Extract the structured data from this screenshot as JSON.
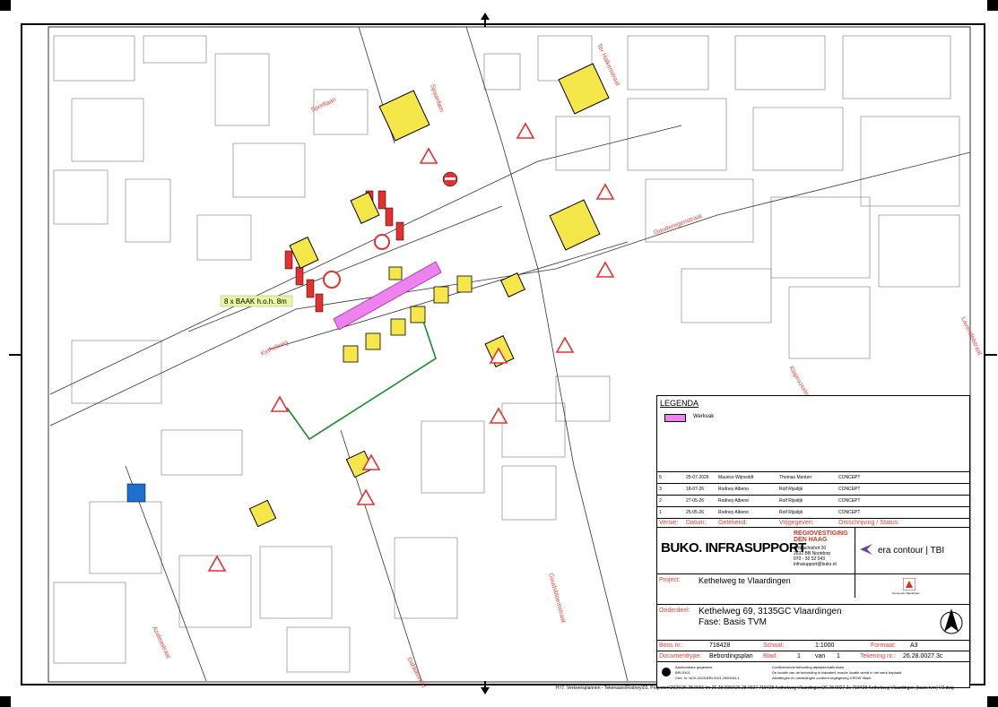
{
  "map_labels": {
    "streets": [
      "Sportlaan",
      "Spaardam",
      "Ter Halkenstraat",
      "Gouderegenstraat",
      "Klaproosstraat",
      "Lavendelstraat",
      "Kethelweg",
      "Goudsbloemstraat",
      "Azaleastraat",
      "Dahliastraat"
    ],
    "callout": "8 x BAAK h.o.h. 8m"
  },
  "legend": {
    "title": "LEGENDA",
    "items": [
      {
        "label": "Werkvak",
        "color": "#ee82ee"
      }
    ]
  },
  "revisions": {
    "headers": [
      "Versie:",
      "Datum:",
      "Getekend:",
      "Vrijgegeven:",
      "Omschrijving / Status:"
    ],
    "rows": [
      [
        "5",
        "25-07-2026",
        "Maurice Wijnvoldt",
        "Thomas Munten",
        "CONCEPT"
      ],
      [
        "3",
        "18-07-26",
        "Rodney Albeno",
        "Rolf Rijsdijk",
        "CONCEPT"
      ],
      [
        "2",
        "27-05-26",
        "Rodney Albeno",
        "Rolf Rijsdijk",
        "CONCEPT"
      ],
      [
        "1",
        "25-05-26",
        "Rodney Albeno",
        "Rolf Rijsdijk",
        "CONCEPT"
      ]
    ]
  },
  "company": {
    "logo": "BUKO. INFRASUPPORT",
    "region_title": "REGIOVESTIGING DEN HAAG",
    "address": [
      "Ambachtshof 20",
      "2632 BB Nootdorp",
      "070 - 30 52 043",
      "infrasupport@buko.nl"
    ],
    "partner": "era contour | TBI",
    "municipality": "Gemeente Vlaardingen"
  },
  "project": {
    "project_label": "Project:",
    "project": "Kethelweg te Vlaardingen",
    "onderdeel_label": "Onderdeel:",
    "onderdeel_line1": "Kethelweg 69, 3135GC Vlaardingen",
    "onderdeel_line2": "Fase: Basis TVM"
  },
  "meta": {
    "boss_label": "Boss nr.:",
    "boss": "718428",
    "schaal_label": "Schaal:",
    "schaal": "1:1000",
    "formaat_label": "Formaat:",
    "formaat": "A3",
    "doc_label": "Documenttype:",
    "doc": "Bebordingsplan",
    "blad_label": "Blad:",
    "blad": "1",
    "van": "van",
    "blad_total": "1",
    "tekening_label": "Tekening nr.:",
    "tekening": "26.28.0027.3c"
  },
  "notes": [
    "Conflicterende bebording afplakken/afkruisen",
    "De locatie van de bebording is indicatief, exacte locatie wordt in het werk bepaald",
    "Afzettingen en omleidingen conform regelgeving CROW 96a/b"
  ],
  "cert": [
    "Aantoonbare gegevens",
    "BRL9101",
    "Cert. nr. NCK.2025.BRL9101.2500004-1"
  ],
  "file_path": "H:\\7. Verkeersplannen - Tekenaars\\Rodney\\01. Projecten\\2026\\26.28.0001 tm 26.28.0050\\26.28.0027 718428 Kethelweg Vlaardingen\\26.28.0027.3c 718428 Kethelweg Vlaardingen (basis tvm) V2.dwg"
}
